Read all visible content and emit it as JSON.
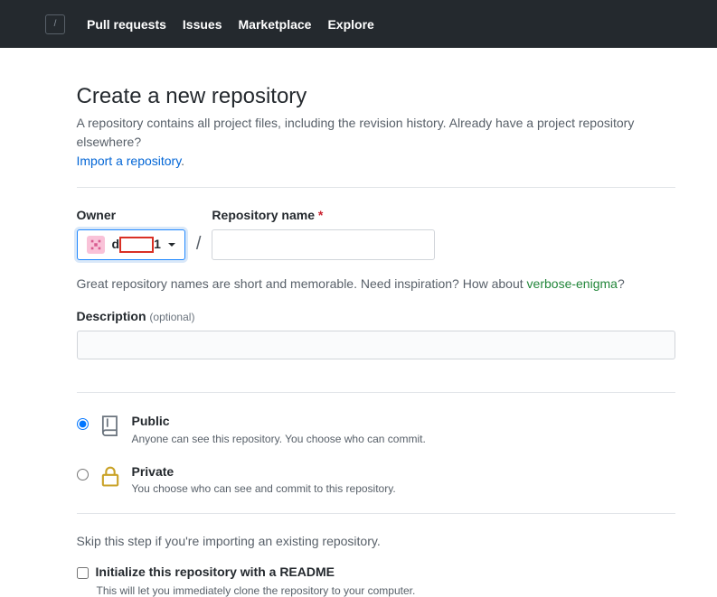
{
  "header": {
    "nav": {
      "pull_requests": "Pull requests",
      "issues": "Issues",
      "marketplace": "Marketplace",
      "explore": "Explore"
    }
  },
  "page": {
    "title": "Create a new repository",
    "subtitle_pre": "A repository contains all project files, including the revision history. Already have a project repository elsewhere? ",
    "import_link": "Import a repository",
    "subtitle_post": "."
  },
  "form": {
    "owner_label": "Owner",
    "owner_name_prefix": "d",
    "owner_name_suffix": "1",
    "repo_name_label": "Repository name",
    "slash": "/",
    "hint_pre": "Great repository names are short and memorable. Need inspiration? How about ",
    "hint_suggestion": "verbose-enigma",
    "hint_post": "?",
    "desc_label": "Description",
    "desc_optional": "(optional)",
    "visibility": {
      "public_title": "Public",
      "public_desc": "Anyone can see this repository. You choose who can commit.",
      "private_title": "Private",
      "private_desc": "You choose who can see and commit to this repository."
    },
    "skip_text": "Skip this step if you're importing an existing repository.",
    "readme_label": "Initialize this repository with a README",
    "readme_desc": "This will let you immediately clone the repository to your computer."
  }
}
